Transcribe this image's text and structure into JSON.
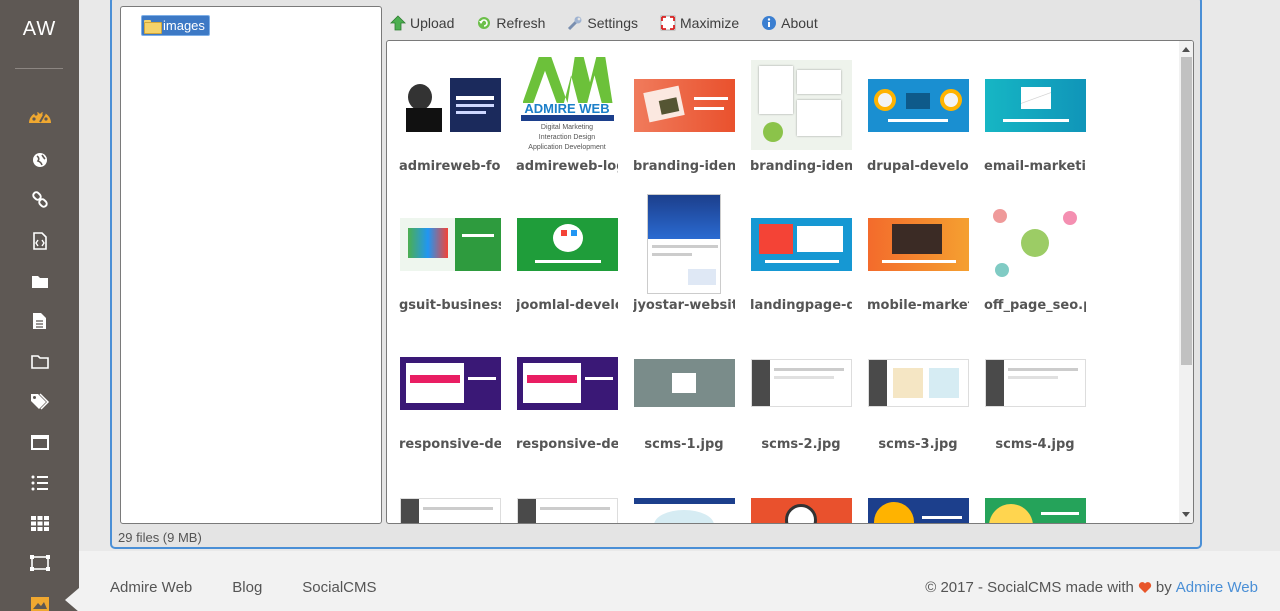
{
  "sidebar": {
    "logo": "AW",
    "icons": [
      "dashboard-icon",
      "globe-icon",
      "link-icon",
      "code-file-icon",
      "folder-filled-icon",
      "document-icon",
      "folder-outline-icon",
      "tags-icon",
      "window-icon",
      "list-icon",
      "grid-icon",
      "sitemap-icon",
      "image-icon"
    ]
  },
  "tree": {
    "root_label": "images"
  },
  "toolbar": {
    "upload": "Upload",
    "refresh": "Refresh",
    "settings": "Settings",
    "maximize": "Maximize",
    "about": "About"
  },
  "files": [
    {
      "name": "admireweb-fou",
      "thumb": "admireweb-founder"
    },
    {
      "name": "admireweb-logo",
      "thumb": "admireweb-logo"
    },
    {
      "name": "branding-identi",
      "thumb": "branding-identity-1"
    },
    {
      "name": "branding-identi",
      "thumb": "branding-identity-2"
    },
    {
      "name": "drupal-develop",
      "thumb": "drupal-development"
    },
    {
      "name": "email-marketin",
      "thumb": "email-marketing"
    },
    {
      "name": "gsuit-businesse",
      "thumb": "gsuit-business"
    },
    {
      "name": "joomlal-develop",
      "thumb": "joomla-development"
    },
    {
      "name": "jyostar-website",
      "thumb": "jyostar-website"
    },
    {
      "name": "landingpage-de",
      "thumb": "landingpage-design"
    },
    {
      "name": "mobile-marketi",
      "thumb": "mobile-marketing"
    },
    {
      "name": "off_page_seo.p",
      "thumb": "off-page-seo"
    },
    {
      "name": "responsive-desi",
      "thumb": "responsive-design-1"
    },
    {
      "name": "responsive-desi",
      "thumb": "responsive-design-2"
    },
    {
      "name": "scms-1.jpg",
      "thumb": "scms-1"
    },
    {
      "name": "scms-2.jpg",
      "thumb": "scms-2"
    },
    {
      "name": "scms-3.jpg",
      "thumb": "scms-3"
    },
    {
      "name": "scms-4.jpg",
      "thumb": "scms-4"
    },
    {
      "name": "",
      "thumb": "scms-5"
    },
    {
      "name": "",
      "thumb": "scms-6"
    },
    {
      "name": "",
      "thumb": "marketing-wordcloud"
    },
    {
      "name": "",
      "thumb": "seo"
    },
    {
      "name": "",
      "thumb": "social-media-management"
    },
    {
      "name": "",
      "thumb": "user-experience"
    }
  ],
  "thumb_text": {
    "admireweb_logo_title": "ADMIRE WEB",
    "admireweb_logo_lines": [
      "Digital Marketing",
      "Interaction Design",
      "Application Development"
    ]
  },
  "status": "29 files (9 MB)",
  "footer": {
    "links": [
      "Admire Web",
      "Blog",
      "SocialCMS"
    ],
    "copyright_prefix": "© 2017 - SocialCMS made with",
    "copyright_by": "by",
    "copyright_link": "Admire Web"
  },
  "colors": {
    "sidebar_bg": "#5e5854",
    "accent_blue": "#4a8fd6",
    "dashboard_icon": "#f0a830",
    "heart": "#e8552a"
  }
}
